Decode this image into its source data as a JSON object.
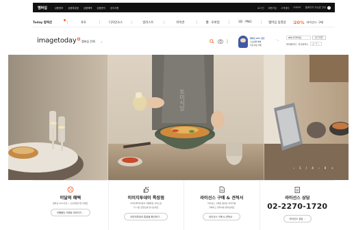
{
  "topbar": {
    "brand": "멤버십",
    "menu": [
      "상품정보",
      "상품특장점",
      "상품혜택",
      "상품문의",
      "공지사항"
    ],
    "right": [
      "로그인",
      "회원가입",
      "고객센터",
      "EVENT"
    ],
    "promo": "홈페이지 리뉴얼 안내"
  },
  "categories": {
    "first": "Today 컬렉션",
    "items": [
      "포토",
      "디자인소스",
      "일러스트",
      "아이콘",
      "웹 · 모바일",
      "3D · PNG",
      "멤버십 동영상"
    ],
    "sale_pct": "20%",
    "sale_label": "라이선스 구매"
  },
  "header": {
    "logo": "imagetoday",
    "search_scope": "멤버십 전체",
    "search_placeholder": ""
  },
  "promo_card": {
    "line1": "멤버십 20% 할인",
    "line2": "신규회원 혜택",
    "line3": "지금 바로 확인"
  },
  "account": {
    "user_id": "abc1234님",
    "logout": "로그아웃",
    "links": [
      "마이페이지",
      "라이트박스"
    ],
    "cart_count": "0"
  },
  "hero": {
    "controls": [
      "‹",
      "1",
      "/",
      "4",
      "›",
      "II",
      "+"
    ],
    "sign_text": "토미식당"
  },
  "info": [
    {
      "title": "이달의 혜택",
      "desc1": "멤버십 20%할인 + 신규회원가입 이벤트",
      "desc2": "",
      "button": "진행중인 이벤트 보러가기",
      "icon": "percent-badge-icon"
    },
    {
      "title": "이미지투데이 특장점",
      "desc1": "이미지투데이만의 차별화된 서비스로",
      "desc2": "더 나은 콘텐츠를 만나보세요",
      "button": "이미지투데이 특장점 확인하기",
      "icon": "thumbs-up-icon"
    },
    {
      "title": "라이선스 구매 & 견적서",
      "desc1": "라이선스 구매로 원하는 이미지를",
      "desc2": "구매하고 견적서를 받아보세요",
      "button": "라이선스 구매 & 견적서",
      "icon": "document-icon"
    },
    {
      "title": "라이선스 상담",
      "desc1": "",
      "desc2": "",
      "phone": "02-2270-1720",
      "button": "라이선스 상담",
      "icon": "clipboard-icon"
    }
  ],
  "colors": {
    "accent": "#ff6b2c",
    "topbar": "#111111",
    "brand_blue": "#2f5fb7"
  }
}
